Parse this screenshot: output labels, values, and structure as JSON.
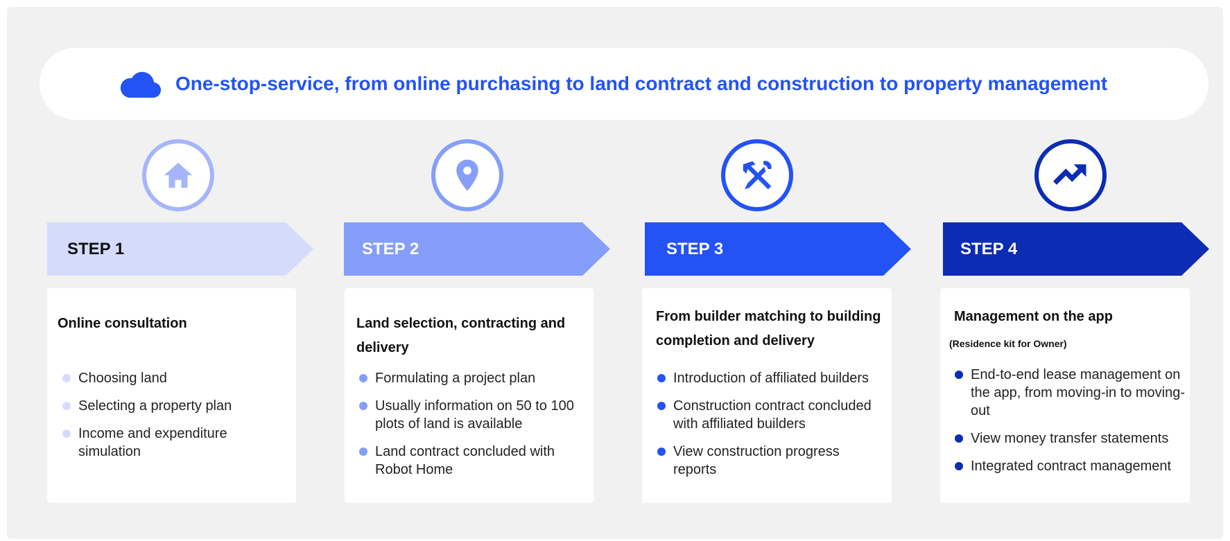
{
  "banner": {
    "icon": "cloud-icon",
    "title": "One-stop-service, from online purchasing to land contract and construction to property management",
    "color": "#2352f5"
  },
  "steps": [
    {
      "label": "STEP 1",
      "icon": "home-icon",
      "color": "#d5dcfb",
      "text_color": "#111111",
      "circle_color": "#a5b5fb",
      "heading": "Online consultation",
      "sub": "",
      "items": [
        "Choosing land",
        "Selecting a property plan",
        "Income and expenditure simulation"
      ],
      "bullet_color": "#d5dcfb"
    },
    {
      "label": "STEP 2",
      "icon": "map-pin-icon",
      "color": "#859efb",
      "text_color": "#ffffff",
      "circle_color": "#859efb",
      "heading": "Land selection, contracting and delivery",
      "sub": "",
      "items": [
        "Formulating a project plan",
        "Usually information on 50 to 100 plots of land is available",
        "Land contract concluded with Robot Home"
      ],
      "bullet_color": "#859efb"
    },
    {
      "label": "STEP 3",
      "icon": "tools-icon",
      "color": "#2352f5",
      "text_color": "#ffffff",
      "circle_color": "#2352f5",
      "heading": "From builder matching to building completion and delivery",
      "sub": "",
      "items": [
        "Introduction of affiliated builders",
        "Construction contract concluded with affiliated builders",
        "View construction progress reports"
      ],
      "bullet_color": "#2352f5"
    },
    {
      "label": "STEP 4",
      "icon": "trending-up-icon",
      "color": "#0b2cb3",
      "text_color": "#ffffff",
      "circle_color": "#0b2cb3",
      "heading": "Management on the app",
      "sub": "(Residence kit for Owner)",
      "items": [
        "End-to-end lease management on the app, from moving-in to moving-out",
        "View money transfer statements",
        "Integrated contract management"
      ],
      "bullet_color": "#0b2cb3"
    }
  ]
}
